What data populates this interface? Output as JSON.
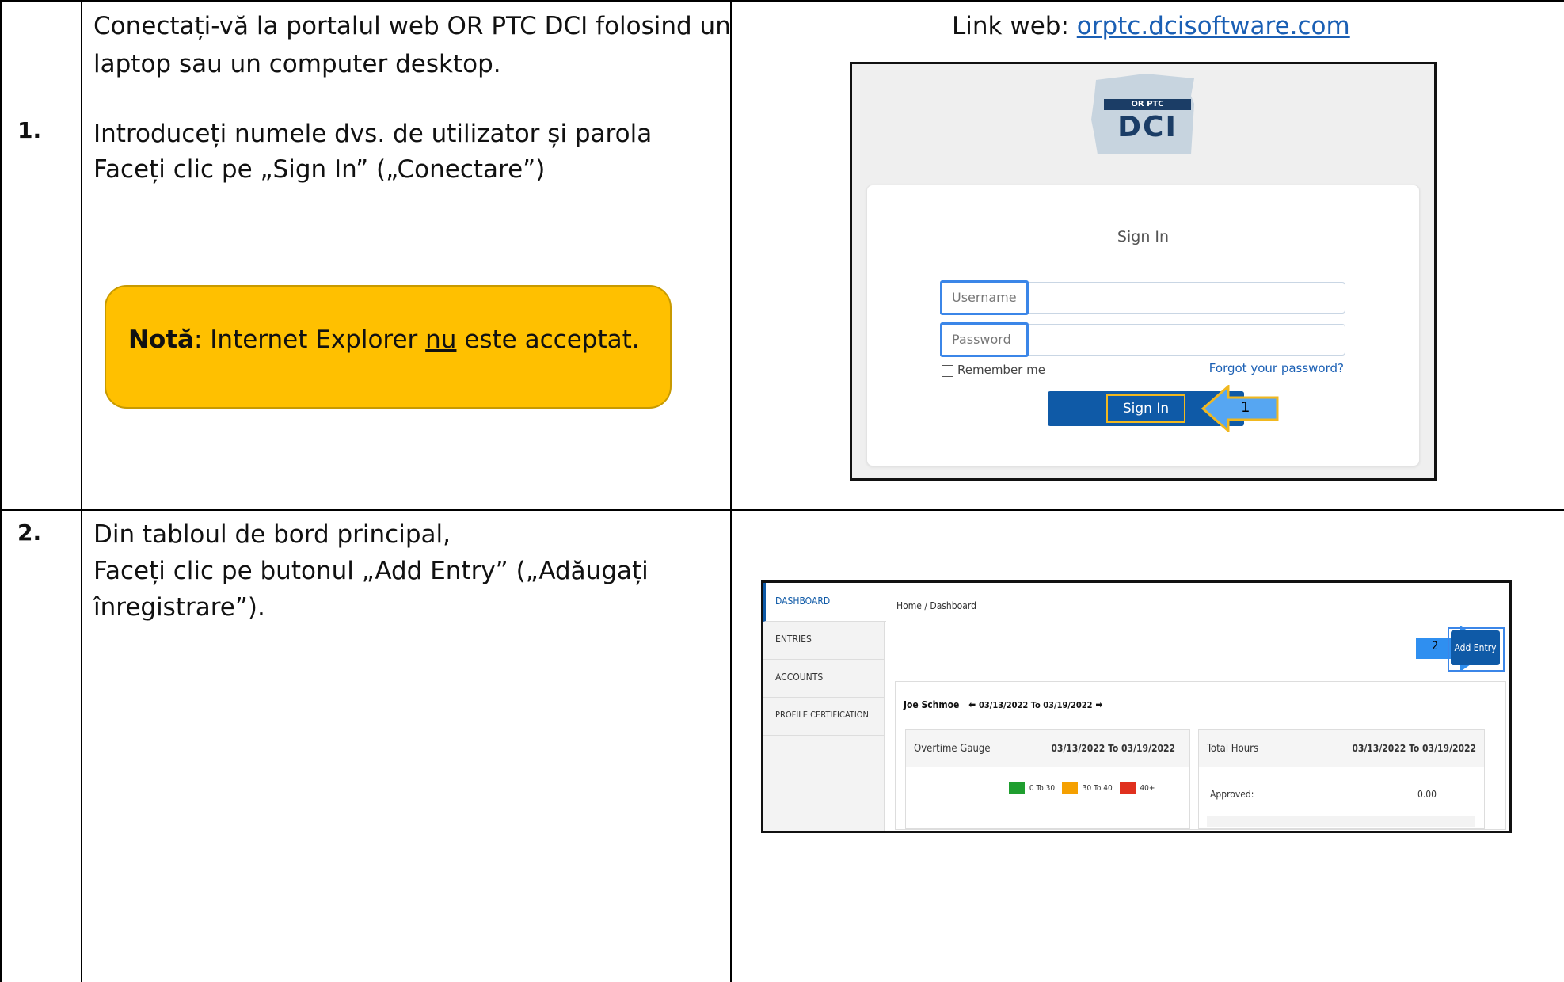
{
  "step1": {
    "number": "1.",
    "line1": "Conectați-vă la portalul web OR PTC DCI folosind un",
    "line2": "laptop sau un computer desktop.",
    "line3": "Introduceți numele dvs. de utilizator și parola",
    "line4": "Faceți clic pe „Sign In” („Conectare”)",
    "note_bold": "Notă",
    "note_pre": ": Internet Explorer ",
    "note_under": "nu",
    "note_post": " este acceptat.",
    "link_label": "Link web: ",
    "link_url": "orptc.dcisoftware.com"
  },
  "signin": {
    "logo_top": "OR PTC",
    "logo_text": "DCI",
    "title": "Sign In",
    "username_placeholder": "Username",
    "password_placeholder": "Password",
    "remember": "Remember me",
    "forgot": "Forgot your password?",
    "button": "Sign In",
    "callout": "1"
  },
  "step2": {
    "number": "2.",
    "line1": "Din tabloul de bord principal,",
    "line2": "Faceți clic pe butonul „Add Entry” („Adăugați",
    "line3": "înregistrare”)."
  },
  "dashboard": {
    "nav": [
      "DASHBOARD",
      "ENTRIES",
      "ACCOUNTS",
      "PROFILE CERTIFICATION"
    ],
    "breadcrumb": "Home / Dashboard",
    "add_entry": "Add Entry",
    "callout": "2",
    "user": "Joe Schmoe",
    "range": "03/13/2022 To 03/19/2022",
    "overtime_title": "Overtime Gauge",
    "overtime_range": "03/13/2022 To 03/19/2022",
    "legend": [
      {
        "label": "0 To 30",
        "color": "#1f9e2f"
      },
      {
        "label": "30 To 40",
        "color": "#f5a000"
      },
      {
        "label": "40+",
        "color": "#e0301e"
      }
    ],
    "total_title": "Total Hours",
    "total_range": "03/13/2022 To 03/19/2022",
    "approved_label": "Approved:",
    "approved_value": "0.00"
  }
}
